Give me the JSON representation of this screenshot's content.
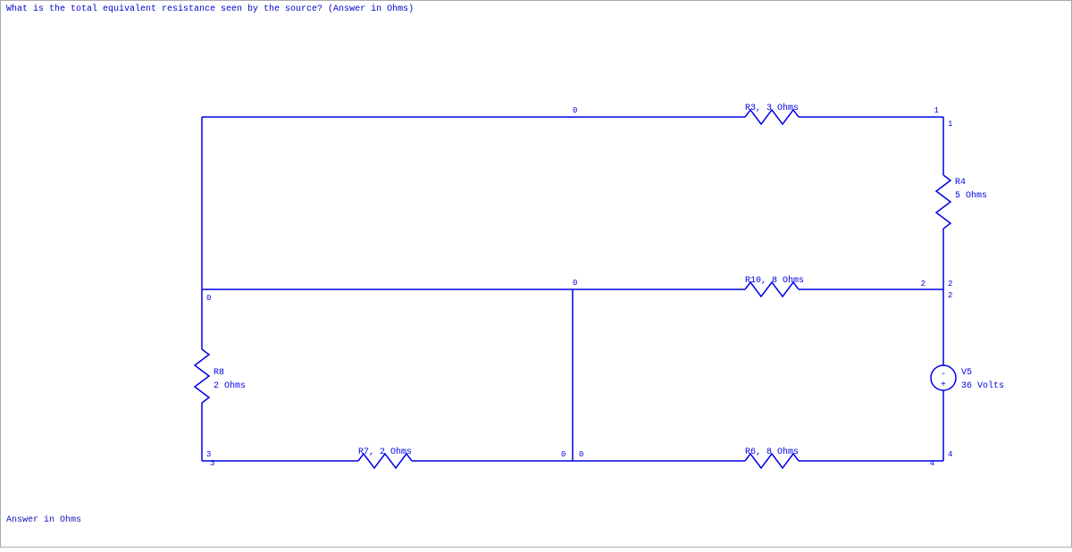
{
  "question": "What is the total equivalent resistance seen by the source? (Answer in Ohms)",
  "answer_prompt": "Answer in Ohms",
  "components": {
    "R3": {
      "name": "R3",
      "value": "3 Ohms"
    },
    "R4": {
      "name": "R4",
      "value": "5 Ohms"
    },
    "R6": {
      "name": "R6",
      "value": "8 Ohms"
    },
    "R7": {
      "name": "R7",
      "value": "2 Ohms"
    },
    "R8": {
      "name": "R8",
      "value": "2 Ohms"
    },
    "R10": {
      "name": "R10",
      "value": "8 Ohms"
    },
    "V5": {
      "name": "V5",
      "value": "36 Volts",
      "pos": "+",
      "neg": "-"
    }
  },
  "nodes": {
    "n0a": "0",
    "n0b": "0",
    "n0c": "0",
    "n0d": "0",
    "n0e": "0",
    "n1a": "1",
    "n1b": "1",
    "n2a": "2",
    "n2b": "2",
    "n2c": "2",
    "n3a": "3",
    "n3b": "3",
    "n4a": "4",
    "n4b": "4"
  }
}
